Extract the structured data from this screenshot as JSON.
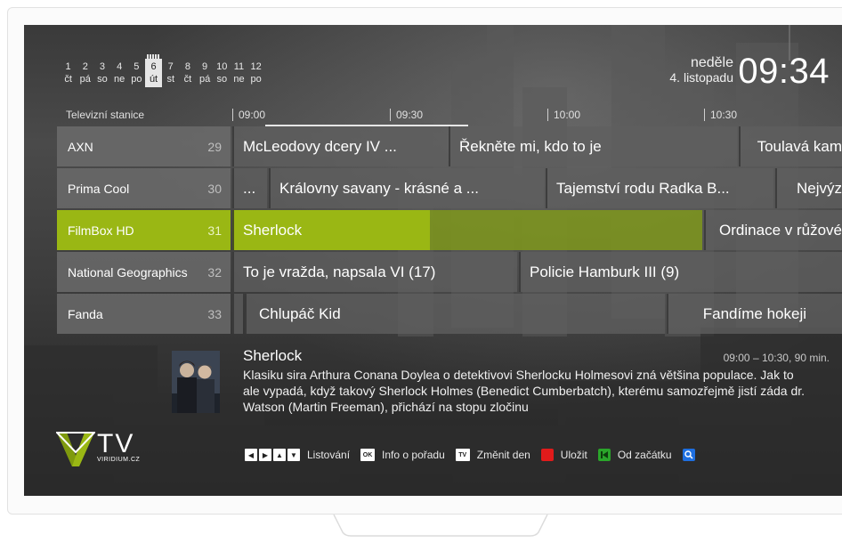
{
  "dates": [
    {
      "num": "1",
      "day": "čt"
    },
    {
      "num": "2",
      "day": "pá"
    },
    {
      "num": "3",
      "day": "so"
    },
    {
      "num": "4",
      "day": "ne"
    },
    {
      "num": "5",
      "day": "po"
    },
    {
      "num": "6",
      "day": "út",
      "selected": true
    },
    {
      "num": "7",
      "day": "st"
    },
    {
      "num": "8",
      "day": "čt"
    },
    {
      "num": "9",
      "day": "pá"
    },
    {
      "num": "10",
      "day": "so"
    },
    {
      "num": "11",
      "day": "ne"
    },
    {
      "num": "12",
      "day": "po"
    }
  ],
  "clock": {
    "weekday": "neděle",
    "date": "4. listopadu",
    "time": "09:34"
  },
  "timeline": {
    "station_header": "Televizní stanice",
    "marks": [
      "09:00",
      "09:30",
      "10:00",
      "10:30"
    ]
  },
  "channels": [
    {
      "name": "AXN",
      "number": "29",
      "programs": [
        "McLeodovy dcery IV ...",
        "Řekněte mi, kdo to je",
        "Toulavá kam"
      ]
    },
    {
      "name": "Prima Cool",
      "number": "30",
      "programs": [
        "...",
        "Královny savany - krásné a ...",
        "Tajemství rodu Radka B...",
        "Nejvýz"
      ]
    },
    {
      "name": "FilmBox HD",
      "number": "31",
      "active": true,
      "programs": [
        "Sherlock",
        "Ordinace v růžové"
      ]
    },
    {
      "name": "National Geographics",
      "number": "32",
      "programs": [
        "To je vražda, napsala VI (17)",
        "Policie Hamburk III (9)"
      ]
    },
    {
      "name": "Fanda",
      "number": "33",
      "programs": [
        "Chlupáč Kid",
        "Fandíme hokeji"
      ]
    }
  ],
  "detail": {
    "title": "Sherlock",
    "time": "09:00 – 10:30, 90 min.",
    "description": "Klasiku sira Arthura Conana Doylea o detektivovi Sherlocku Holmesovi zná většina populace. Jak to ale vypadá, když takový Sherlock Holmes (Benedict Cumberbatch), kterému samozřejmě jistí záda dr. Watson (Martin Freeman), přichází na stopu zločinu"
  },
  "logo": {
    "text": "TV",
    "sub": "VIRIDIUM.CZ"
  },
  "legend": {
    "browse": "Listování",
    "ok_key": "OK",
    "info": "Info o pořadu",
    "tv_key": "TV",
    "change_day": "Změnit den",
    "save": "Uložit",
    "from_start": "Od začátku"
  },
  "colors": {
    "accent_green": "#9ab714",
    "key_red": "#e11b1b",
    "key_green": "#2aa52a",
    "key_blue": "#1e6fe0"
  }
}
